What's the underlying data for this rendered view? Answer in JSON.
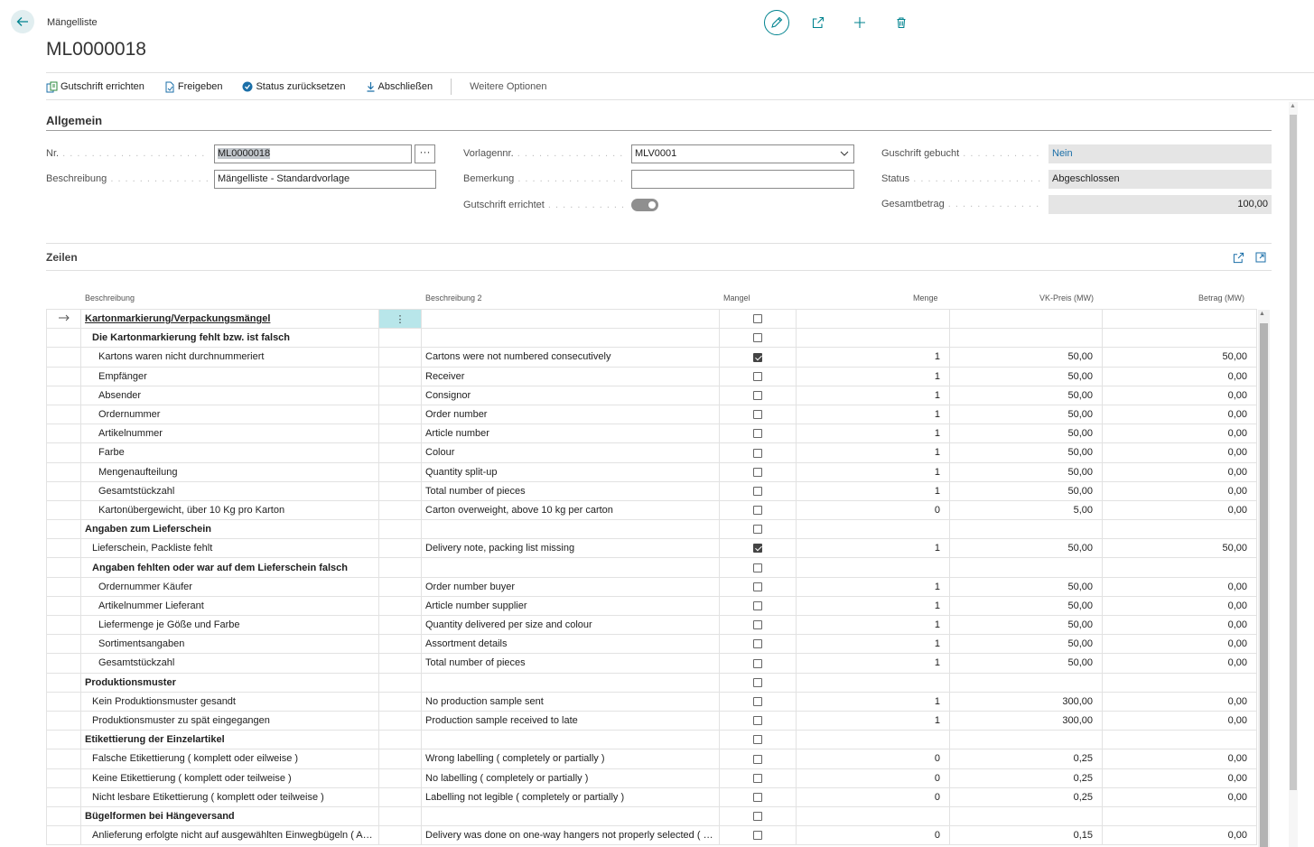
{
  "header": {
    "breadcrumb": "Mängelliste",
    "title": "ML0000018"
  },
  "actions": {
    "gutschrift": "Gutschrift errichten",
    "freigeben": "Freigeben",
    "status_reset": "Status zurücksetzen",
    "abschliessen": "Abschließen",
    "weitere": "Weitere Optionen"
  },
  "general": {
    "section_title": "Allgemein",
    "nr_label": "Nr.",
    "nr_value": "ML0000018",
    "beschreibung_label": "Beschreibung",
    "beschreibung_value": "Mängelliste - Standardvorlage",
    "vorlagennr_label": "Vorlagennr.",
    "vorlagennr_value": "MLV0001",
    "bemerkung_label": "Bemerkung",
    "bemerkung_value": "",
    "gutschrift_errichtet_label": "Gutschrift errichtet",
    "gutschrift_errichtet_on": true,
    "guschrift_gebucht_label": "Guschrift gebucht",
    "guschrift_gebucht_value": "Nein",
    "status_label": "Status",
    "status_value": "Abgeschlossen",
    "gesamtbetrag_label": "Gesamtbetrag",
    "gesamtbetrag_value": "100,00"
  },
  "lines": {
    "section_title": "Zeilen",
    "columns": {
      "beschreibung": "Beschreibung",
      "beschreibung2": "Beschreibung 2",
      "mangel": "Mangel",
      "menge": "Menge",
      "vkpreis": "VK-Preis (MW)",
      "betrag": "Betrag (MW)"
    },
    "rows": [
      {
        "desc": "Kartonmarkierung/Verpackungsmängel",
        "desc2": "",
        "mangel": false,
        "menge": "",
        "preis": "",
        "betrag": "",
        "style": "link",
        "indent": 0,
        "current": true
      },
      {
        "desc": "Die Kartonmarkierung fehlt bzw. ist falsch",
        "desc2": "",
        "mangel": false,
        "menge": "",
        "preis": "",
        "betrag": "",
        "style": "bold",
        "indent": 1
      },
      {
        "desc": "Kartons waren nicht durchnummeriert",
        "desc2": "Cartons were not numbered consecutively",
        "mangel": true,
        "menge": "1",
        "preis": "50,00",
        "betrag": "50,00",
        "style": "",
        "indent": 2
      },
      {
        "desc": "Empfänger",
        "desc2": "Receiver",
        "mangel": false,
        "menge": "1",
        "preis": "50,00",
        "betrag": "0,00",
        "style": "",
        "indent": 2
      },
      {
        "desc": "Absender",
        "desc2": "Consignor",
        "mangel": false,
        "menge": "1",
        "preis": "50,00",
        "betrag": "0,00",
        "style": "",
        "indent": 2
      },
      {
        "desc": "Ordernummer",
        "desc2": "Order number",
        "mangel": false,
        "menge": "1",
        "preis": "50,00",
        "betrag": "0,00",
        "style": "",
        "indent": 2
      },
      {
        "desc": "Artikelnummer",
        "desc2": "Article number",
        "mangel": false,
        "menge": "1",
        "preis": "50,00",
        "betrag": "0,00",
        "style": "",
        "indent": 2
      },
      {
        "desc": "Farbe",
        "desc2": "Colour",
        "mangel": false,
        "menge": "1",
        "preis": "50,00",
        "betrag": "0,00",
        "style": "",
        "indent": 2
      },
      {
        "desc": "Mengenaufteilung",
        "desc2": "Quantity split-up",
        "mangel": false,
        "menge": "1",
        "preis": "50,00",
        "betrag": "0,00",
        "style": "",
        "indent": 2
      },
      {
        "desc": "Gesamtstückzahl",
        "desc2": "Total number of pieces",
        "mangel": false,
        "menge": "1",
        "preis": "50,00",
        "betrag": "0,00",
        "style": "",
        "indent": 2
      },
      {
        "desc": "Kartonübergewicht, über 10 Kg pro Karton",
        "desc2": "Carton overweight, above 10 kg per carton",
        "mangel": false,
        "menge": "0",
        "preis": "5,00",
        "betrag": "0,00",
        "style": "",
        "indent": 2
      },
      {
        "desc": "Angaben zum Lieferschein",
        "desc2": "",
        "mangel": false,
        "menge": "",
        "preis": "",
        "betrag": "",
        "style": "bold",
        "indent": 0
      },
      {
        "desc": "Lieferschein, Packliste fehlt",
        "desc2": "Delivery note, packing list missing",
        "mangel": true,
        "menge": "1",
        "preis": "50,00",
        "betrag": "50,00",
        "style": "",
        "indent": 1
      },
      {
        "desc": "Angaben fehlten oder war auf dem Lieferschein falsch",
        "desc2": "",
        "mangel": false,
        "menge": "",
        "preis": "",
        "betrag": "",
        "style": "bold",
        "indent": 1
      },
      {
        "desc": "Ordernummer Käufer",
        "desc2": "Order number buyer",
        "mangel": false,
        "menge": "1",
        "preis": "50,00",
        "betrag": "0,00",
        "style": "",
        "indent": 2
      },
      {
        "desc": "Artikelnummer Lieferant",
        "desc2": "Article number supplier",
        "mangel": false,
        "menge": "1",
        "preis": "50,00",
        "betrag": "0,00",
        "style": "",
        "indent": 2
      },
      {
        "desc": "Liefermenge je Göße und Farbe",
        "desc2": "Quantity delivered per size and colour",
        "mangel": false,
        "menge": "1",
        "preis": "50,00",
        "betrag": "0,00",
        "style": "",
        "indent": 2
      },
      {
        "desc": "Sortimentsangaben",
        "desc2": "Assortment details",
        "mangel": false,
        "menge": "1",
        "preis": "50,00",
        "betrag": "0,00",
        "style": "",
        "indent": 2
      },
      {
        "desc": "Gesamtstückzahl",
        "desc2": "Total number of pieces",
        "mangel": false,
        "menge": "1",
        "preis": "50,00",
        "betrag": "0,00",
        "style": "",
        "indent": 2
      },
      {
        "desc": "Produktionsmuster",
        "desc2": "",
        "mangel": false,
        "menge": "",
        "preis": "",
        "betrag": "",
        "style": "bold",
        "indent": 0
      },
      {
        "desc": "Kein Produktionsmuster gesandt",
        "desc2": "No production sample sent",
        "mangel": false,
        "menge": "1",
        "preis": "300,00",
        "betrag": "0,00",
        "style": "",
        "indent": 1
      },
      {
        "desc": "Produktionsmuster zu spät eingegangen",
        "desc2": "Production sample received to late",
        "mangel": false,
        "menge": "1",
        "preis": "300,00",
        "betrag": "0,00",
        "style": "",
        "indent": 1
      },
      {
        "desc": "Etikettierung der Einzelartikel",
        "desc2": "",
        "mangel": false,
        "menge": "",
        "preis": "",
        "betrag": "",
        "style": "bold",
        "indent": 0
      },
      {
        "desc": "Falsche Etikettierung ( komplett oder eilweise )",
        "desc2": "Wrong labelling ( completely or partially )",
        "mangel": false,
        "menge": "0",
        "preis": "0,25",
        "betrag": "0,00",
        "style": "",
        "indent": 1
      },
      {
        "desc": "Keine Etikettierung ( komplett oder teilweise )",
        "desc2": "No labelling ( completely or partially )",
        "mangel": false,
        "menge": "0",
        "preis": "0,25",
        "betrag": "0,00",
        "style": "",
        "indent": 1
      },
      {
        "desc": "Nicht lesbare Etikettierung ( komplett oder teilweise )",
        "desc2": "Labelling not legible ( completely or partially )",
        "mangel": false,
        "menge": "0",
        "preis": "0,25",
        "betrag": "0,00",
        "style": "",
        "indent": 1
      },
      {
        "desc": "Bügelformen bei Hängeversand",
        "desc2": "",
        "mangel": false,
        "menge": "",
        "preis": "",
        "betrag": "",
        "style": "bold",
        "indent": 0
      },
      {
        "desc": "Anlieferung erfolgte nicht auf ausgewählten Einwegbügeln ( Anza...",
        "desc2": "Delivery was done on one-way hangers not properly selected ( Num...",
        "mangel": false,
        "menge": "0",
        "preis": "0,15",
        "betrag": "0,00",
        "style": "",
        "indent": 1
      }
    ]
  }
}
